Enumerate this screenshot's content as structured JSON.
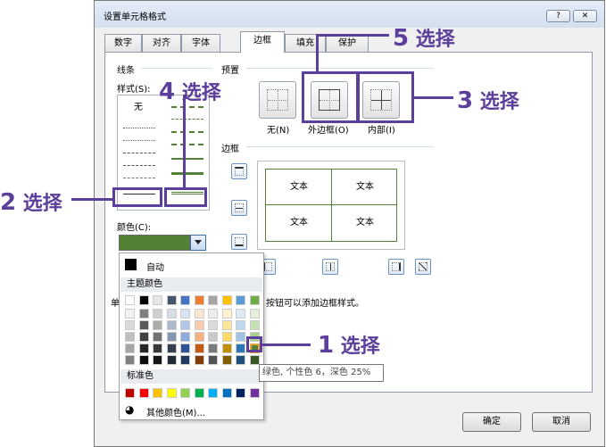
{
  "dialog": {
    "title": "设置单元格格式",
    "help_label": "?",
    "close_label": "✕"
  },
  "tabs": [
    {
      "label": "数字"
    },
    {
      "label": "对齐"
    },
    {
      "label": "字体"
    },
    {
      "label": "边框"
    },
    {
      "label": "填充"
    },
    {
      "label": "保护"
    }
  ],
  "active_tab": "边框",
  "line": {
    "group_label": "线条",
    "style_label": "样式(S):",
    "none_label": "无",
    "color_label": "颜色(C):",
    "selected_color": "#538135"
  },
  "presets": {
    "group_label": "预置",
    "none": "无(N)",
    "outline": "外边框(O)",
    "inside": "内部(I)"
  },
  "border": {
    "group_label": "边框",
    "cells": [
      "文本",
      "文本",
      "文本",
      "文本"
    ]
  },
  "hint_text": "单击预置选项、预览草图及上面的按钮可以添加边框样式。",
  "hint_visible": "按钮可以添加边框样式。",
  "hint_prefix": "单",
  "color_popup": {
    "auto_label": "自动",
    "theme_label": "主题颜色",
    "standard_label": "标准色",
    "more_label": "其他颜色(M)...",
    "theme_top": [
      "#ffffff",
      "#000000",
      "#e7e6e6",
      "#44546a",
      "#4472c4",
      "#ed7d31",
      "#a5a5a5",
      "#ffc000",
      "#5b9bd5",
      "#70ad47"
    ],
    "theme_columns": [
      [
        "#f2f2f2",
        "#d9d9d9",
        "#bfbfbf",
        "#a6a6a6",
        "#808080"
      ],
      [
        "#7f7f7f",
        "#595959",
        "#404040",
        "#262626",
        "#0d0d0d"
      ],
      [
        "#d0cece",
        "#aeabab",
        "#757171",
        "#3a3838",
        "#171616"
      ],
      [
        "#d6dce4",
        "#adb9ca",
        "#8497b0",
        "#333f4f",
        "#222a35"
      ],
      [
        "#d9e2f3",
        "#b4c6e7",
        "#8eaadb",
        "#2f5496",
        "#1f3864"
      ],
      [
        "#fbe5d5",
        "#f7cbac",
        "#f4b183",
        "#c55a11",
        "#833c0b"
      ],
      [
        "#ededed",
        "#dbdbdb",
        "#c9c9c9",
        "#7b7b7b",
        "#525252"
      ],
      [
        "#fff2cc",
        "#ffe599",
        "#ffd966",
        "#bf9000",
        "#7f6000"
      ],
      [
        "#deebf6",
        "#bdd7ee",
        "#9dc3e6",
        "#2e75b5",
        "#1e4e79"
      ],
      [
        "#e2efd9",
        "#c5e0b3",
        "#a8d08d",
        "#538135",
        "#375623"
      ]
    ],
    "standard": [
      "#c00000",
      "#ff0000",
      "#ffc000",
      "#ffff00",
      "#92d050",
      "#00b050",
      "#00b0f0",
      "#0070c0",
      "#002060",
      "#7030a0"
    ],
    "selected_tooltip": "绿色, 个性色 6，深色 25%"
  },
  "buttons": {
    "ok": "确定",
    "cancel": "取消"
  },
  "callouts": {
    "c1": {
      "num": "1",
      "text": " 选择"
    },
    "c2": {
      "num": "2",
      "text": " 选择"
    },
    "c3": {
      "num": "3",
      "text": " 选择"
    },
    "c4": {
      "num": "4",
      "text": " 选择"
    },
    "c5": {
      "num": "5",
      "text": " 选择"
    }
  }
}
